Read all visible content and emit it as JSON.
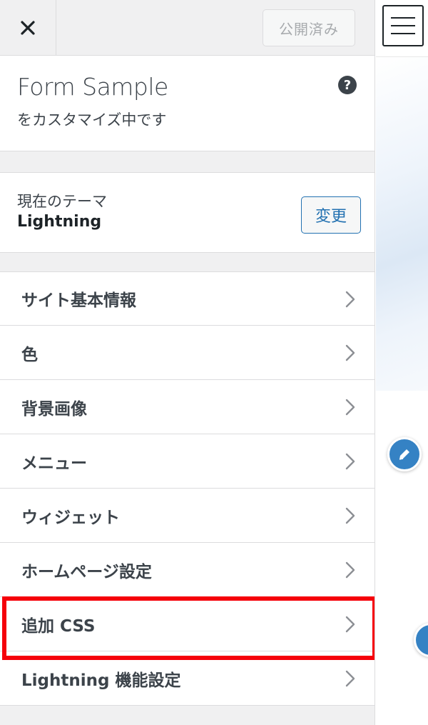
{
  "header": {
    "close_icon": "close-icon",
    "publish_label": "公開済み"
  },
  "site_info": {
    "title": "Form Sample",
    "subtitle": "をカスタマイズ中です",
    "help_icon": "help-icon",
    "help_glyph": "?"
  },
  "theme": {
    "label": "現在のテーマ",
    "name": "Lightning",
    "change_label": "変更"
  },
  "menu": {
    "items": [
      {
        "label": "サイト基本情報"
      },
      {
        "label": "色"
      },
      {
        "label": "背景画像"
      },
      {
        "label": "メニュー"
      },
      {
        "label": "ウィジェット"
      },
      {
        "label": "ホームページ設定"
      },
      {
        "label": "追加 CSS",
        "highlighted": true
      },
      {
        "label": "Lightning 機能設定"
      }
    ]
  },
  "colors": {
    "accent": "#2271b1",
    "highlight_border": "#f5000a",
    "edit_shortcut": "#3582c4"
  }
}
